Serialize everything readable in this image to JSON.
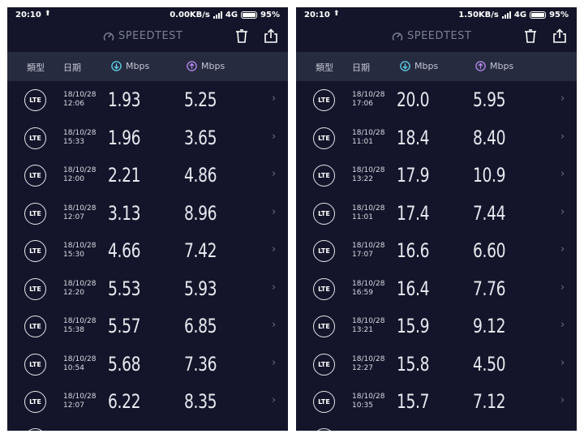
{
  "header": {
    "logo_text": "SPEEDTEST",
    "col_type": "類型",
    "col_date": "日期",
    "col_download": "Mbps",
    "col_upload": "Mbps"
  },
  "screens": [
    {
      "status": {
        "time": "20:10",
        "speed": "0.00KB/s",
        "network": "4G",
        "battery": "95%"
      },
      "rows": [
        {
          "type": "LTE",
          "date": "18/10/28",
          "time": "12:06",
          "down": "1.93",
          "up": "5.25"
        },
        {
          "type": "LTE",
          "date": "18/10/28",
          "time": "15:33",
          "down": "1.96",
          "up": "3.65"
        },
        {
          "type": "LTE",
          "date": "18/10/28",
          "time": "12:00",
          "down": "2.21",
          "up": "4.86"
        },
        {
          "type": "LTE",
          "date": "18/10/28",
          "time": "12:07",
          "down": "3.13",
          "up": "8.96"
        },
        {
          "type": "LTE",
          "date": "18/10/28",
          "time": "15:30",
          "down": "4.66",
          "up": "7.42"
        },
        {
          "type": "LTE",
          "date": "18/10/28",
          "time": "12:20",
          "down": "5.53",
          "up": "5.93"
        },
        {
          "type": "LTE",
          "date": "18/10/28",
          "time": "15:38",
          "down": "5.57",
          "up": "6.85"
        },
        {
          "type": "LTE",
          "date": "18/10/28",
          "time": "10:54",
          "down": "5.68",
          "up": "7.36"
        },
        {
          "type": "LTE",
          "date": "18/10/28",
          "time": "12:07",
          "down": "6.22",
          "up": "8.35"
        }
      ]
    },
    {
      "status": {
        "time": "20:10",
        "speed": "1.50KB/s",
        "network": "4G",
        "battery": "95%"
      },
      "rows": [
        {
          "type": "LTE",
          "date": "18/10/28",
          "time": "17:06",
          "down": "20.0",
          "up": "5.95"
        },
        {
          "type": "LTE",
          "date": "18/10/28",
          "time": "11:01",
          "down": "18.4",
          "up": "8.40"
        },
        {
          "type": "LTE",
          "date": "18/10/28",
          "time": "13:22",
          "down": "17.9",
          "up": "10.9"
        },
        {
          "type": "LTE",
          "date": "18/10/28",
          "time": "11:01",
          "down": "17.4",
          "up": "7.44"
        },
        {
          "type": "LTE",
          "date": "18/10/28",
          "time": "17:07",
          "down": "16.6",
          "up": "6.60"
        },
        {
          "type": "LTE",
          "date": "18/10/28",
          "time": "16:59",
          "down": "16.4",
          "up": "7.76"
        },
        {
          "type": "LTE",
          "date": "18/10/28",
          "time": "13:21",
          "down": "15.9",
          "up": "9.12"
        },
        {
          "type": "LTE",
          "date": "18/10/28",
          "time": "12:27",
          "down": "15.8",
          "up": "4.50"
        },
        {
          "type": "LTE",
          "date": "18/10/28",
          "time": "10:35",
          "down": "15.7",
          "up": "7.12"
        }
      ]
    }
  ],
  "icons": {
    "logo": "speedometer-icon",
    "trash": "trash-icon",
    "share": "share-icon",
    "download": "download-arrow-icon",
    "upload": "upload-arrow-icon",
    "row_chevron": "chevron-right-icon",
    "status_upload": "upload-indicator-icon"
  },
  "colors": {
    "background": "#14152a",
    "header_bar": "#272b40",
    "download_accent": "#5fd4e8",
    "upload_accent": "#b98cf0",
    "muted_text": "#7b7f91"
  }
}
